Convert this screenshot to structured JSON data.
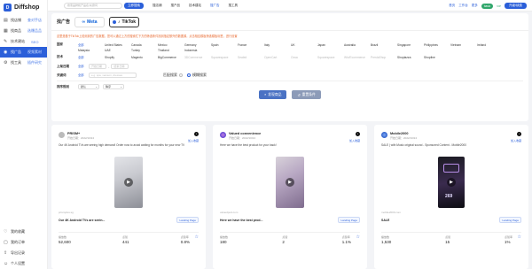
{
  "app": {
    "logo_letter": "D",
    "name": "Diffshop"
  },
  "sidebar": {
    "items": [
      {
        "icon": "book-icon",
        "label": "找店铺",
        "sub": "查对手店"
      },
      {
        "icon": "product-icon",
        "label": "找商品",
        "sub": "选爆品品"
      },
      {
        "icon": "tech-icon",
        "label": "技术建站",
        "sub": "SEO"
      },
      {
        "icon": "megaphone-icon",
        "label": "找广告",
        "sub": "视频素材"
      },
      {
        "icon": "tools-icon",
        "label": "找工具",
        "sub": "插件研究"
      }
    ],
    "bottom": [
      {
        "icon": "collection-icon",
        "label": "我的收藏"
      },
      {
        "icon": "order-icon",
        "label": "我的订单"
      },
      {
        "icon": "export-icon",
        "label": "导出记录"
      },
      {
        "icon": "user-icon",
        "label": "个人设置"
      }
    ]
  },
  "topbar": {
    "search_placeholder": "搜索品牌和产品名/关键词",
    "search_button": "立即搜索",
    "nav": [
      "搜店铺",
      "搜产品",
      "技术建站",
      "搜广告",
      "搜工具"
    ],
    "active_nav": "搜广告",
    "links": [
      "首页",
      "工作台",
      "更多"
    ],
    "badge": "basic",
    "vip": "VIP",
    "upgrade": "升级/续费"
  },
  "filters": {
    "label": "找广告",
    "platforms": [
      "Meta",
      "TikTok"
    ],
    "active_platform": "TikTok",
    "notice": "这里是基于TikTok上检测到的广告数据，您可以通过上方的搜索栏下方的筛选条件找到指定额外的数据源，点击相应模板筛选模板标签，进行设置",
    "country_label": "国家",
    "countries": [
      "全部",
      "United States",
      "Canada",
      "Mexico",
      "Germany",
      "Spain",
      "France",
      "Italy",
      "UK",
      "Japan",
      "Australia",
      "Brazil",
      "Singapore",
      "Philippines",
      "Vietnam",
      "Ireland",
      "Malaysia",
      "UAE",
      "Turkey",
      "Thailand",
      "Indonesia"
    ],
    "tech_label": "技术",
    "techs": [
      "全部",
      "Shopify",
      "Magento",
      "BigCommerce",
      "3DCommerce",
      "Squarespace",
      "Sealed",
      "OpenCart",
      "Ocsa",
      "Squarespace",
      "Wix/Ecommerce",
      "PrestaShop",
      "Shoplazza",
      "Shopline"
    ],
    "date_label": "上架日期",
    "date_all": "全部",
    "date_start": "开始日期",
    "date_end": "结束日期",
    "keyword_label": "关键词",
    "keyword_all": "全部",
    "keyword_placeholder": "e.g. spa, vacuum, dresses",
    "match_options": [
      "匹配搜索",
      "模糊搜索"
    ],
    "sort_label": "排序规则",
    "sort_value": "默认",
    "sort_order": "降序",
    "search_btn": "发现商品",
    "reset_btn": "重置条件"
  },
  "cards": [
    {
      "title": "PRISM+",
      "time": "开始日期：2022/10/24",
      "join": "加入收藏",
      "desc": "Our 4K Android TVs are seeing high demand! Order now to avoid waiting for months for your new TV",
      "domain": "prismplus.sg",
      "ad_text": "Our 4K Android TVs are seein...",
      "landing": "Landing Page",
      "stats": [
        {
          "label": "播放数",
          "value": "52,600"
        },
        {
          "label": "点赞",
          "value": "441"
        },
        {
          "label": "点赞率",
          "value": "0.8%"
        }
      ]
    },
    {
      "title": "Valued convenience",
      "time": "开始日期：2022/10/24",
      "join": "加入收藏",
      "desc": "Here we have the best product for your back!",
      "domain": "valuedpod.com",
      "ad_text": "Here we have the best prod...",
      "landing": "Landing Page",
      "stats": [
        {
          "label": "播放数",
          "value": "180"
        },
        {
          "label": "点赞",
          "value": "2"
        },
        {
          "label": "点赞率",
          "value": "1.1%"
        }
      ]
    },
    {
      "title": "Mobile2000",
      "time": "开始日期：2022/10/24",
      "join": "加入收藏",
      "desc": "SALE | with Music original sound - Sponsored Content - Mobile2000",
      "domain": "mobile2000.com",
      "ad_text": "SALE",
      "landing": "Landing Page",
      "price": "269",
      "stats": [
        {
          "label": "播放数",
          "value": "1,530"
        },
        {
          "label": "点赞",
          "value": "15"
        },
        {
          "label": "点赞率",
          "value": "1%"
        }
      ]
    }
  ]
}
